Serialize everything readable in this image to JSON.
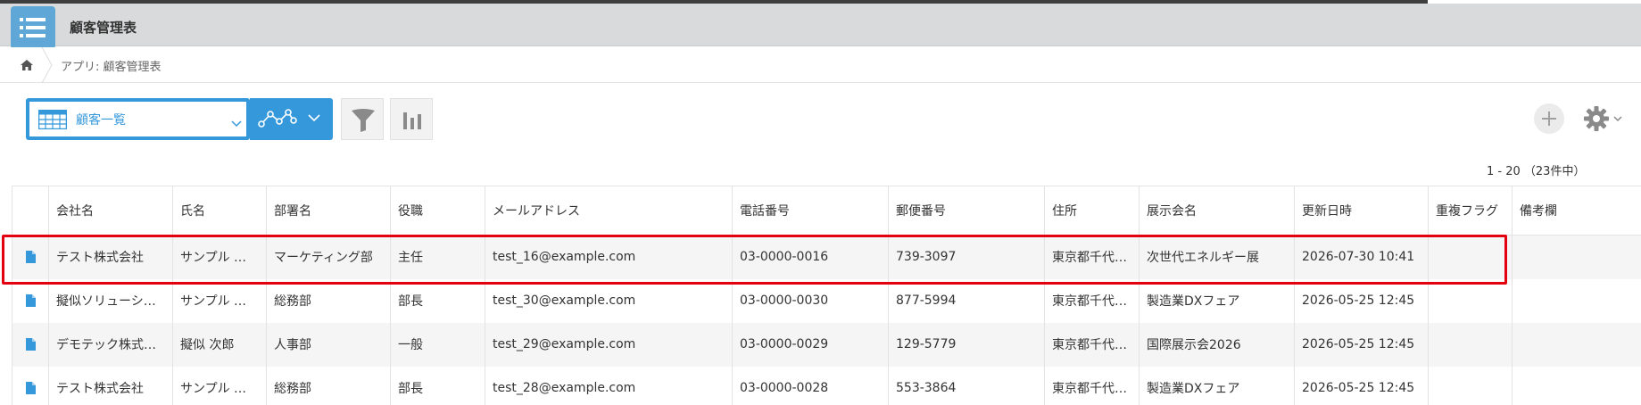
{
  "app": {
    "title": "顧客管理表",
    "icon": "list-icon"
  },
  "breadcrumb": {
    "home_icon": "home-icon",
    "text": "アプリ: 顧客管理表"
  },
  "toolbar": {
    "view_label": "顧客一覧",
    "view_icon": "table-icon",
    "graph_icon": "graph-icon",
    "filter_icon": "filter-icon",
    "chart_icon": "bar-chart-icon",
    "add_icon": "plus-icon",
    "settings_icon": "gear-icon",
    "accent_color": "#3498db"
  },
  "pagination": {
    "text": "1 - 20 （23件中）"
  },
  "table": {
    "columns": [
      "会社名",
      "氏名",
      "部署名",
      "役職",
      "メールアドレス",
      "電話番号",
      "郵便番号",
      "住所",
      "展示会名",
      "更新日時",
      "重複フラグ",
      "備考欄"
    ],
    "rows": [
      [
        "テスト株式会社",
        "サンプル 太郎",
        "マーケティング部",
        "主任",
        "test_16@example.com",
        "03-0000-0016",
        "739-3097",
        "東京都千代…",
        "次世代エネルギー展",
        "2026-07-30 10:41",
        "",
        ""
      ],
      [
        "擬似ソリューショ…",
        "サンプル 三郎",
        "総務部",
        "部長",
        "test_30@example.com",
        "03-0000-0030",
        "877-5994",
        "東京都千代…",
        "製造業DXフェア",
        "2026-05-25 12:45",
        "",
        ""
      ],
      [
        "デモテック株式会社",
        "擬似 次郎",
        "人事部",
        "一般",
        "test_29@example.com",
        "03-0000-0029",
        "129-5779",
        "東京都千代…",
        "国際展示会2026",
        "2026-05-25 12:45",
        "",
        ""
      ],
      [
        "テスト株式会社",
        "サンプル 花子",
        "総務部",
        "部長",
        "test_28@example.com",
        "03-0000-0028",
        "553-3864",
        "東京都千代…",
        "製造業DXフェア",
        "2026-05-25 12:45",
        "",
        ""
      ]
    ]
  },
  "highlight": {
    "color": "#e3000f"
  }
}
